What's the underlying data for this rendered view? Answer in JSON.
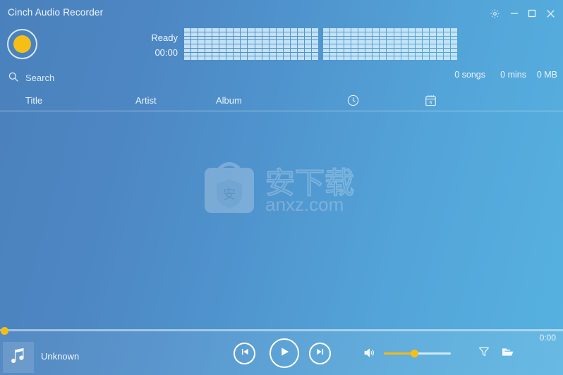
{
  "window": {
    "title": "Cinch Audio Recorder",
    "controls": [
      {
        "name": "settings",
        "icon": "gear-icon",
        "label": "Settings"
      },
      {
        "name": "minimize",
        "icon": "minimize-icon",
        "label": "Minimize"
      },
      {
        "name": "maximize",
        "icon": "maximize-icon",
        "label": "Maximize"
      },
      {
        "name": "close",
        "icon": "close-icon",
        "label": "Close"
      }
    ]
  },
  "recorder": {
    "record_button_label": "Record",
    "status": "Ready",
    "elapsed": "00:00",
    "visualizer": {
      "panels": 2,
      "columns": 19,
      "rows": 8,
      "segment_color": "#cfe9f8"
    }
  },
  "search": {
    "icon": "search-icon",
    "placeholder": "Search",
    "value": ""
  },
  "library_stats": {
    "songs": "0 songs",
    "duration": "0 mins",
    "size": "0 MB"
  },
  "columns": [
    {
      "key": "title",
      "label": "Title"
    },
    {
      "key": "artist",
      "label": "Artist"
    },
    {
      "key": "album",
      "label": "Album"
    },
    {
      "key": "duration",
      "label": "",
      "icon": "clock-icon"
    },
    {
      "key": "date_added",
      "label": "",
      "icon": "calendar-icon",
      "day": "6"
    }
  ],
  "rows": [],
  "watermark": {
    "text": "anxz.com",
    "badge_char": "安"
  },
  "player": {
    "seek": {
      "position_percent": 0,
      "handle_color": "#f7bf16"
    },
    "time_remaining": "0:00",
    "album_art_icon": "music-note-icon",
    "track_title": "Unknown",
    "buttons": [
      {
        "name": "previous",
        "icon": "previous-icon",
        "label": "Previous"
      },
      {
        "name": "play",
        "icon": "play-icon",
        "label": "Play"
      },
      {
        "name": "next",
        "icon": "next-icon",
        "label": "Next"
      }
    ],
    "volume": {
      "icon": "volume-icon",
      "level_percent": 45,
      "fill_color": "#f2b81c",
      "track_color": "#cfe7f7"
    },
    "filter_button": {
      "icon": "filter-icon",
      "label": "Filter"
    },
    "folder_button": {
      "icon": "folder-open-icon",
      "label": "Open Folder"
    }
  },
  "theme": {
    "bg_left": "#4a81bd",
    "bg_right": "#56b2e0",
    "accent": "#f7bf16",
    "text": "#ffffff"
  }
}
